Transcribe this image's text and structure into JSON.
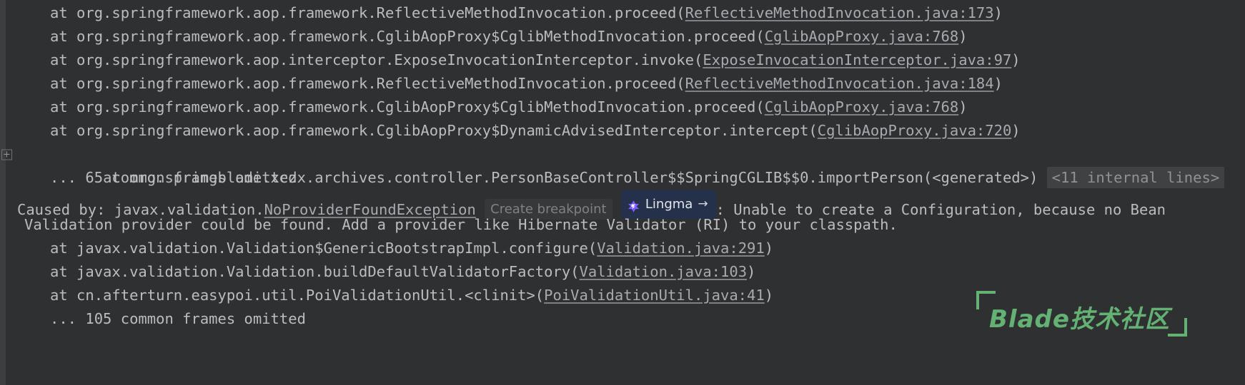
{
  "console": {
    "background_color": "#2f3032",
    "gutter_color": "#3c3f41",
    "text_color": "#bbbcbd",
    "link_color": "#a8aab0"
  },
  "gutter": {
    "expand_icon_label": "+"
  },
  "lines": [
    {
      "prefix": "at org.springframework.aop.framework.ReflectiveMethodInvocation.proceed(",
      "link": "ReflectiveMethodInvocation.java:173",
      "suffix": ")"
    },
    {
      "prefix": "at org.springframework.aop.framework.CglibAopProxy$CglibMethodInvocation.proceed(",
      "link": "CglibAopProxy.java:768",
      "suffix": ")"
    },
    {
      "prefix": "at org.springframework.aop.interceptor.ExposeInvocationInterceptor.invoke(",
      "link": "ExposeInvocationInterceptor.java:97",
      "suffix": ")"
    },
    {
      "prefix": "at org.springframework.aop.framework.ReflectiveMethodInvocation.proceed(",
      "link": "ReflectiveMethodInvocation.java:184",
      "suffix": ")"
    },
    {
      "prefix": "at org.springframework.aop.framework.CglibAopProxy$CglibMethodInvocation.proceed(",
      "link": "CglibAopProxy.java:768",
      "suffix": ")"
    },
    {
      "prefix": "at org.springframework.aop.framework.CglibAopProxy$DynamicAdvisedInterceptor.intercept(",
      "link": "CglibAopProxy.java:720",
      "suffix": ")"
    }
  ],
  "generated_line": {
    "text": "at org.springblade.xczx.archives.controller.PersonBaseController$$SpringCGLIB$$0.importPerson(<generated>)",
    "internal_lines_badge": "<11 internal lines>"
  },
  "omitted_first": "... 65 common frames omitted",
  "caused_by": {
    "prefix": "Caused by: javax.validation.",
    "exception_link": "NoProviderFoundException",
    "breakpoint_badge": "Create breakpoint",
    "lingma_badge": {
      "label": "Lingma",
      "arrow": "→",
      "background_color": "#25314a",
      "icon_color": "#7c5cff"
    },
    "message_part1": ": Unable to create a Configuration, because no Bean",
    "message_part2": "Validation provider could be found. Add a provider like Hibernate Validator (RI) to your classpath."
  },
  "cause_frames": [
    {
      "prefix": "at javax.validation.Validation$GenericBootstrapImpl.configure(",
      "link": "Validation.java:291",
      "suffix": ")"
    },
    {
      "prefix": "at javax.validation.Validation.buildDefaultValidatorFactory(",
      "link": "Validation.java:103",
      "suffix": ")"
    },
    {
      "prefix": "at cn.afterturn.easypoi.util.PoiValidationUtil.<clinit>(",
      "link": "PoiValidationUtil.java:41",
      "suffix": ")"
    }
  ],
  "omitted_second": "... 105 common frames omitted",
  "watermark": {
    "text": "Blade技术社区",
    "color": "#63b173"
  }
}
